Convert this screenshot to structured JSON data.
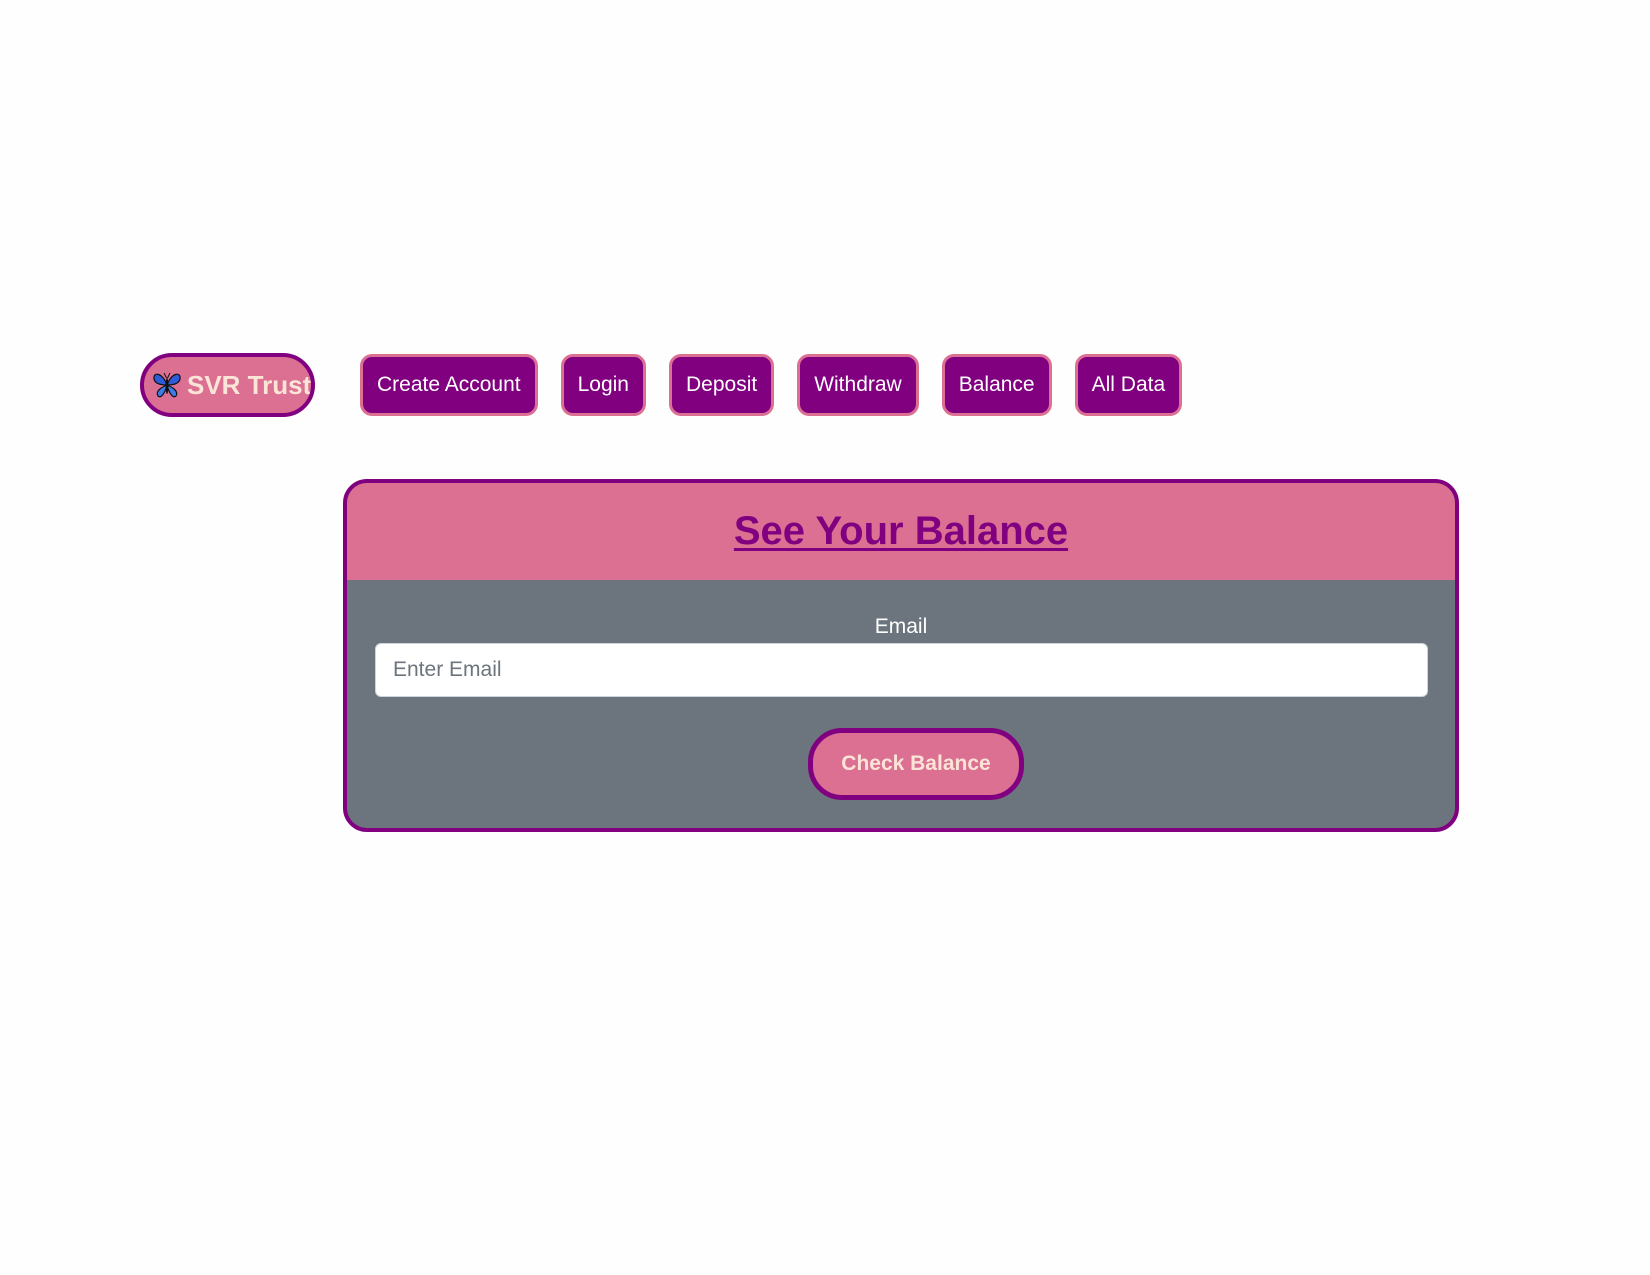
{
  "navbar": {
    "brand": {
      "label": "SVR Trust",
      "icon": "butterfly-icon"
    },
    "items": [
      {
        "label": "Create Account"
      },
      {
        "label": "Login"
      },
      {
        "label": "Deposit"
      },
      {
        "label": "Withdraw"
      },
      {
        "label": "Balance"
      },
      {
        "label": "All Data"
      }
    ]
  },
  "card": {
    "title": "See Your Balance",
    "email": {
      "label": "Email",
      "placeholder": "Enter Email",
      "value": ""
    },
    "submit_label": "Check Balance"
  },
  "colors": {
    "primary_purple": "#800080",
    "pale_violet_red": "#db7093",
    "card_body_gray": "#6c757d",
    "brand_text": "#fce4d6",
    "background": "#fefefe"
  }
}
